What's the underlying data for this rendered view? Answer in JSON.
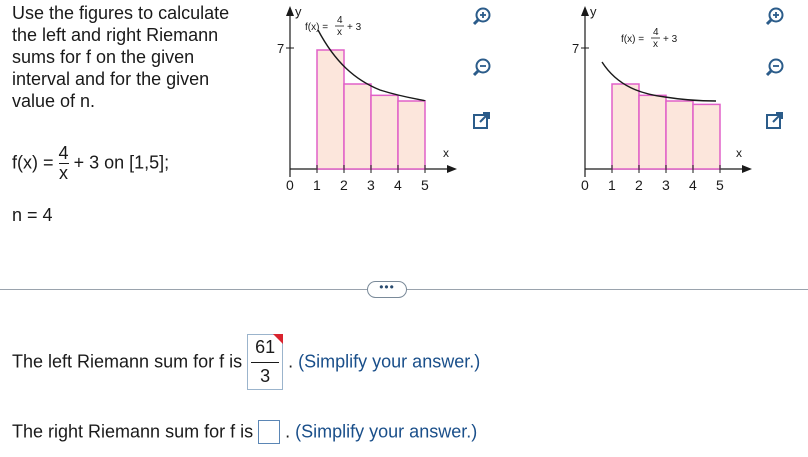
{
  "prompt": {
    "text": "Use the figures to calculate the left and right Riemann sums for f on the given interval and for the given value of n."
  },
  "function": {
    "lhs": "f(x) =",
    "numerator": "4",
    "denominator": "x",
    "rest": "+ 3 on [1,5];"
  },
  "n_line": "n = 4",
  "graph_left": {
    "y_axis_label": "y",
    "x_axis_label": "x",
    "y_tick": "7",
    "x_ticks": [
      "0",
      "1",
      "2",
      "3",
      "4",
      "5"
    ],
    "f_lhs": "f(x) =",
    "f_num": "4",
    "f_den": "x",
    "f_rest": "+ 3",
    "rect_heights": [
      7,
      5,
      4.333,
      4
    ]
  },
  "graph_right": {
    "y_axis_label": "y",
    "x_axis_label": "x",
    "y_tick": "7",
    "x_ticks": [
      "0",
      "1",
      "2",
      "3",
      "4",
      "5"
    ],
    "f_lhs": "f(x) =",
    "f_num": "4",
    "f_den": "x",
    "f_rest": "+ 3",
    "rect_heights": [
      5,
      4.333,
      4,
      3.8
    ]
  },
  "tools": {
    "zoom_in_icon": "magnifier-plus",
    "zoom_out_icon": "magnifier-minus",
    "popout_icon": "external-link"
  },
  "more_button": "•••",
  "left_sum": {
    "label": "The left Riemann sum for f is",
    "numerator": "61",
    "denominator": "3",
    "period": ".",
    "hint": "(Simplify your answer.)"
  },
  "right_sum": {
    "label": "The right Riemann sum for f is",
    "value": "",
    "period": ".",
    "hint": "(Simplify your answer.)"
  },
  "colors": {
    "rect_fill": "#fce6dc",
    "rect_stroke": "#e060c8",
    "tool_color": "#2b5c8a",
    "answer_marker": "#d9232e"
  }
}
